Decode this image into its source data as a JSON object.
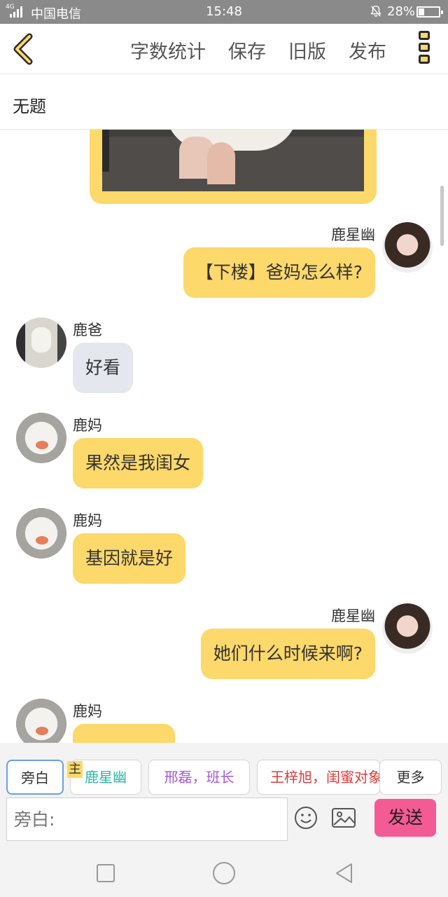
{
  "status_bar": {
    "carrier": "中国电信",
    "network": "4G",
    "time": "15:48",
    "battery": "28%",
    "battery_level": 0.28
  },
  "toolbar": {
    "actions": [
      "字数统计",
      "保存",
      "旧版",
      "发布"
    ]
  },
  "document": {
    "title": "无题"
  },
  "messages": [
    {
      "sender": "鹿星幽",
      "side": "right",
      "text": "【下楼】爸妈怎么样?",
      "style": "yellow"
    },
    {
      "sender": "鹿爸",
      "side": "left",
      "text": "好看",
      "style": "gray"
    },
    {
      "sender": "鹿妈",
      "side": "left",
      "text": "果然是我闺女",
      "style": "yellow"
    },
    {
      "sender": "鹿妈",
      "side": "left",
      "text": "基因就是好",
      "style": "yellow"
    },
    {
      "sender": "鹿星幽",
      "side": "right",
      "text": "她们什么时候来啊?",
      "style": "yellow"
    },
    {
      "sender": "鹿妈",
      "side": "left",
      "text": "",
      "style": "yellow"
    }
  ],
  "roles": [
    {
      "label": "旁白",
      "color": "#333333",
      "active": true
    },
    {
      "label": "鹿星幽",
      "color": "#2bb6a8",
      "host_tag": "主"
    },
    {
      "label": "邢磊，班长",
      "color": "#a45ad8"
    },
    {
      "label": "王梓旭，闺蜜对象",
      "color": "#e03b3b"
    },
    {
      "label": "更多",
      "color": "#333333"
    }
  ],
  "composer": {
    "placeholder": "旁白:",
    "send_label": "发送"
  }
}
